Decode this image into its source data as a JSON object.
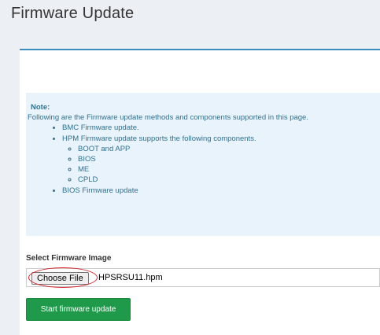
{
  "page": {
    "title": "Firmware Update"
  },
  "note": {
    "title": "Note:",
    "intro": "Following are the Firmware update methods and components supported in this page.",
    "methods": [
      {
        "label": "BMC Firmware update."
      },
      {
        "label": "HPM Firmware update supports the following components.",
        "components": [
          "BOOT and APP",
          "BIOS",
          "ME",
          "CPLD"
        ]
      },
      {
        "label": "BIOS Firmware update"
      }
    ]
  },
  "file_select": {
    "label": "Select Firmware Image",
    "button_label": "Choose File",
    "selected_file": "HPSRSU11.hpm"
  },
  "actions": {
    "start_label": "Start firmware update"
  },
  "colors": {
    "accent_border": "#3c8dbc",
    "note_background": "#e8f3fb",
    "note_text": "#31708f",
    "start_button": "#1f9a4b",
    "highlight_circle": "#d9242b"
  }
}
